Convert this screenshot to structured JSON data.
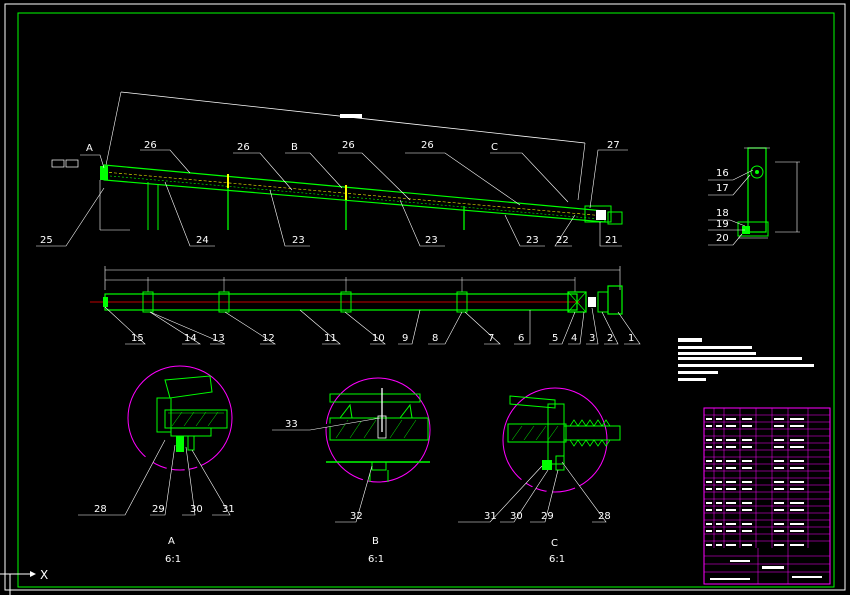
{
  "drawing": {
    "callouts_top": [
      "26",
      "26",
      "B",
      "26",
      "26",
      "C",
      "27",
      "A"
    ],
    "callouts_elev_bottom": [
      "25",
      "24",
      "23",
      "23",
      "23",
      "22",
      "21"
    ],
    "callouts_plan": [
      "15",
      "14",
      "13",
      "12",
      "11",
      "10",
      "9",
      "8",
      "7",
      "6",
      "5",
      "4",
      "3",
      "2",
      "1"
    ],
    "callouts_end_view": [
      "16",
      "17",
      "18",
      "19",
      "20"
    ],
    "callouts_detail_a": [
      "28",
      "29",
      "30",
      "31"
    ],
    "callouts_detail_b": [
      "33",
      "32"
    ],
    "callouts_detail_c": [
      "31",
      "30",
      "29",
      "28"
    ],
    "detail_views": [
      {
        "name": "A",
        "scale": "6:1"
      },
      {
        "name": "B",
        "scale": "6:1"
      },
      {
        "name": "C",
        "scale": "6:1"
      }
    ],
    "ucs_axis_label": "X"
  },
  "colors": {
    "background": "#000000",
    "frame": "#00ff00",
    "geometry": "#00ff00",
    "lines": "#ffffff",
    "centerline": "#ff0000",
    "detail_circle": "#ff00ff",
    "title_block": "#ff00ff",
    "hidden": "#ffff00"
  }
}
